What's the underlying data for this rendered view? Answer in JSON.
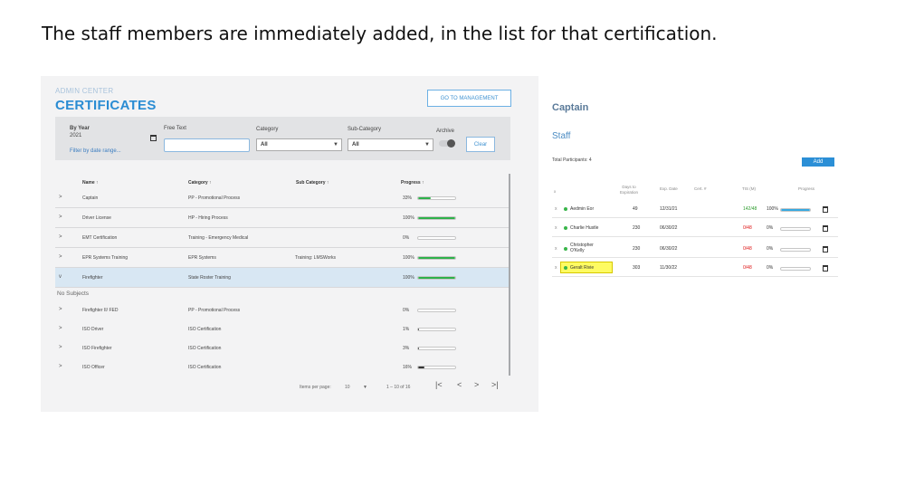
{
  "caption": "The staff members are immediately added, in the list for that certification.",
  "left_panel": {
    "admin_center": "ADMIN CENTER",
    "title": "CERTIFICATES",
    "goto_button": "GO TO MANAGEMENT",
    "filters": {
      "by_year_label": "By Year",
      "year_value": "2021",
      "filter_by_date": "Filter by date range...",
      "free_text_label": "Free Text",
      "free_text_value": "",
      "category_label": "Category",
      "category_value": "All",
      "subcategory_label": "Sub-Category",
      "subcategory_value": "All",
      "archive_label": "Archive",
      "clear_button": "Clear"
    },
    "columns": [
      "Name ↑",
      "Category ↑",
      "Sub Category ↑",
      "Progress ↑"
    ],
    "rows": [
      {
        "chevron": ">",
        "name": "Captain",
        "category": "PP - Promotional Process",
        "subcategory": "",
        "progress_text": "33%",
        "progress": 33,
        "color": "#2eb14a"
      },
      {
        "chevron": ">",
        "name": "Driver License",
        "category": "HP - Hiring Process",
        "subcategory": "",
        "progress_text": "100%",
        "progress": 100,
        "color": "#2eb14a"
      },
      {
        "chevron": ">",
        "name": "EMT Certification",
        "category": "Training - Emergency Medical",
        "subcategory": "",
        "progress_text": "0%",
        "progress": 0,
        "color": "#2eb14a"
      },
      {
        "chevron": ">",
        "name": "EPR Systems Training",
        "category": "EPR Systems",
        "subcategory": "Training: LMSWorks",
        "progress_text": "100%",
        "progress": 100,
        "color": "#2eb14a"
      },
      {
        "chevron": "v",
        "name": "Firefighter",
        "category": "State Roster Training",
        "subcategory": "",
        "progress_text": "100%",
        "progress": 100,
        "color": "#2eb14a"
      }
    ],
    "no_subjects": "No Subjects",
    "rows2": [
      {
        "chevron": ">",
        "name": "Firefighter II/ FED",
        "category": "PP - Promotional Process",
        "progress_text": "0%",
        "progress": 0,
        "color": "#2eb14a"
      },
      {
        "chevron": ">",
        "name": "ISO Driver",
        "category": "ISO Certification",
        "progress_text": "1%",
        "progress": 1,
        "color": "#333333"
      },
      {
        "chevron": ">",
        "name": "ISO Firefighter",
        "category": "ISO Certification",
        "progress_text": "3%",
        "progress": 3,
        "color": "#333333"
      },
      {
        "chevron": ">",
        "name": "ISO Officer",
        "category": "ISO Certification",
        "progress_text": "16%",
        "progress": 16,
        "color": "#333333"
      }
    ],
    "pager": {
      "items_per_page_label": "Items per page:",
      "items_per_page": "10",
      "range": "1 – 10 of 16",
      "first": "|<",
      "prev": "<",
      "next": ">",
      "last": ">|"
    }
  },
  "right_panel": {
    "title": "Captain",
    "staff_label": "Staff",
    "total_participants": "Total Participants: 4",
    "add_button": "Add",
    "columns": {
      "x": "x",
      "days": "Days to Expiration",
      "exp": "Exp. Date",
      "cert": "Cert. #",
      "tis": "TIS (M)",
      "progress": "Progress"
    },
    "staff": [
      {
        "name": "Aedmin Eor",
        "days": "49",
        "exp": "12/31/21",
        "tis": "142/48",
        "tis_color": "#2a9a2a",
        "progress_text": "100%",
        "progress": 100,
        "highlight": false
      },
      {
        "name": "Charlie Hustle",
        "days": "230",
        "exp": "06/30/22",
        "tis": "0/48",
        "tis_color": "#dd1111",
        "progress_text": "0%",
        "progress": 0,
        "highlight": false
      },
      {
        "name": "Christopher O'Kelly",
        "days": "230",
        "exp": "06/30/22",
        "tis": "0/48",
        "tis_color": "#dd1111",
        "progress_text": "0%",
        "progress": 0,
        "highlight": false
      },
      {
        "name": "Geralt Rivie",
        "days": "303",
        "exp": "11/30/22",
        "tis": "0/48",
        "tis_color": "#dd1111",
        "progress_text": "0%",
        "progress": 0,
        "highlight": true
      }
    ]
  }
}
